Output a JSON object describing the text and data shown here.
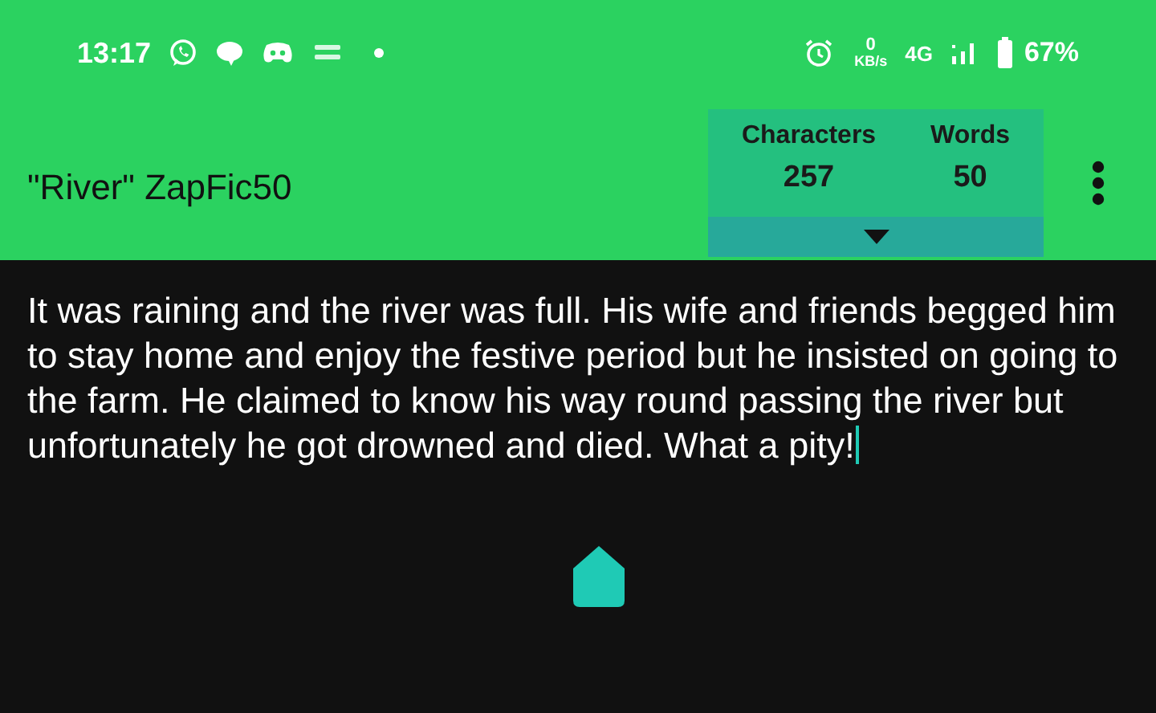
{
  "status_bar": {
    "time": "13:17",
    "network_speed_value": "0",
    "network_speed_unit": "KB/s",
    "network_type": "4G",
    "battery": "67%"
  },
  "app_bar": {
    "title": "\"River\" ZapFic50",
    "stats": [
      {
        "label": "Characters",
        "value": "257"
      },
      {
        "label": "Words",
        "value": "50"
      }
    ]
  },
  "editor": {
    "text": "It was raining and the river was full. His wife and friends begged him to stay home and enjoy the festive period but he insisted on going to the farm. He claimed to know his way round passing the river but unfortunately he got drowned and died. What a pity!"
  }
}
